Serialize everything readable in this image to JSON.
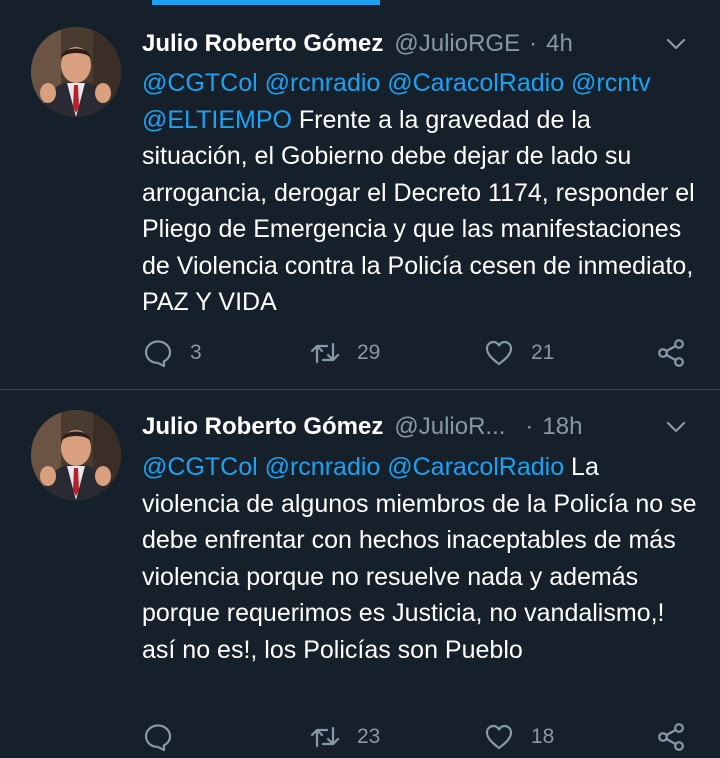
{
  "tweets": [
    {
      "name": "Julio Roberto Gómez",
      "handle": "@JulioRGE",
      "separator": "·",
      "time": "4h",
      "mentions": "@CGTCol @rcnradio @CaracolRadio @rcntv @ELTIEMPO",
      "text": " Frente a la gravedad de la situación, el Gobierno debe dejar de lado su arrogancia, derogar el Decreto 1174, responder el Pliego de Emergencia y que las manifestaciones de Violencia contra la Policía cesen de inmediato, PAZ Y VIDA",
      "replies": "3",
      "retweets": "29",
      "likes": "21"
    },
    {
      "name": "Julio Roberto Gómez",
      "handle": "@JulioR...",
      "separator": "·",
      "time": "18h",
      "mentions": "@CGTCol @rcnradio @CaracolRadio",
      "text": " La violencia de algunos miembros de la Policía no se debe enfrentar con hechos inaceptables de más violencia porque no resuelve nada y además porque requerimos es Justicia, no  vandalismo,! así no es!, los Policías son Pueblo",
      "replies": "",
      "retweets": "23",
      "likes": "18"
    }
  ],
  "icons": {
    "reply": "reply-icon",
    "retweet": "retweet-icon",
    "like": "heart-icon",
    "share": "share-icon",
    "menu": "chevron-down-icon"
  },
  "colors": {
    "background": "#15202b",
    "accent": "#1da1f2",
    "muted": "#8899a6",
    "divider": "#38444d"
  }
}
